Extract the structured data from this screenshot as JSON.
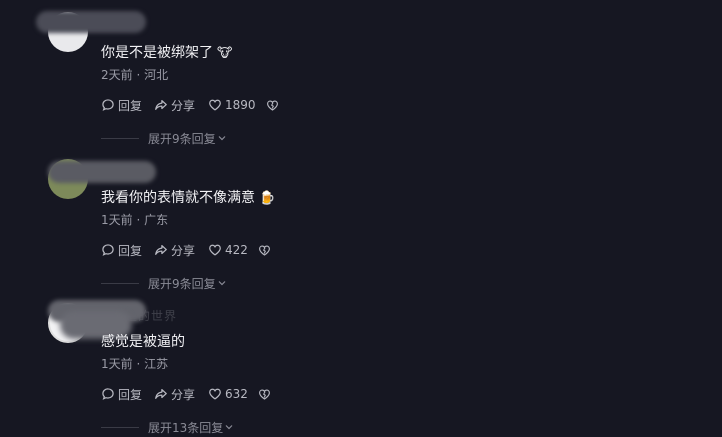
{
  "comments": [
    {
      "text": "你是不是被绑架了",
      "emoji": "🐮",
      "time": "2天前",
      "location": "河北",
      "reply_label": "回复",
      "share_label": "分享",
      "likes": "1890",
      "expand_label": "展开9条回复"
    },
    {
      "text": "我看你的表情就不像满意",
      "emoji": "🍺",
      "time": "1天前",
      "location": "广东",
      "reply_label": "回复",
      "share_label": "分享",
      "likes": "422",
      "expand_label": "展开9条回复"
    },
    {
      "partial_name": "…道的世界",
      "text": "感觉是被逼的",
      "time": "1天前",
      "location": "江苏",
      "reply_label": "回复",
      "share_label": "分享",
      "likes": "632",
      "expand_label": "展开13条回复"
    }
  ],
  "meta_separator": " · ",
  "colors": {
    "background": "#161722",
    "primary_text": "#f1f1f4",
    "secondary_text": "#9a9ba6",
    "action_text": "#b8b9c2"
  },
  "icons": {
    "reply": "chat-bubble-icon",
    "share": "share-arrow-icon",
    "like": "heart-icon",
    "dislike": "broken-heart-icon",
    "expand": "chevron-down-icon"
  }
}
